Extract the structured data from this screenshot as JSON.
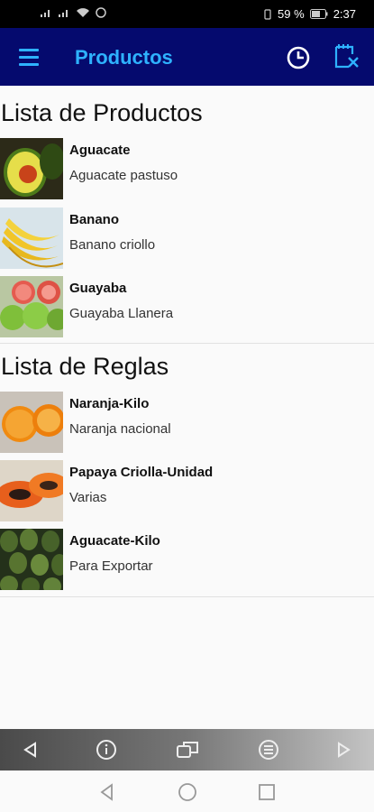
{
  "status_bar": {
    "battery_percent": "59 %",
    "time": "2:37"
  },
  "app_bar": {
    "title": "Productos",
    "icons": [
      "menu-icon",
      "clock-icon",
      "notes-edit-icon"
    ]
  },
  "productos": {
    "title": "Lista de Productos",
    "items": [
      {
        "title": "Aguacate",
        "subtitle": "Aguacate pastuso",
        "image": "avocado-image"
      },
      {
        "title": "Banano",
        "subtitle": "Banano criollo",
        "image": "banana-image"
      },
      {
        "title": "Guayaba",
        "subtitle": "Guayaba Llanera",
        "image": "guava-image"
      }
    ]
  },
  "reglas": {
    "title": "Lista de Reglas",
    "items": [
      {
        "title": "Naranja-Kilo",
        "subtitle": "Naranja nacional",
        "image": "orange-image"
      },
      {
        "title": "Papaya Criolla-Unidad",
        "subtitle": "Varias",
        "image": "papaya-image"
      },
      {
        "title": "Aguacate-Kilo",
        "subtitle": "Para Exportar",
        "image": "avocados-image"
      }
    ]
  },
  "media_bar": {
    "icons": [
      "previous-icon",
      "info-icon",
      "switch-window-icon",
      "menu-circle-icon",
      "next-icon"
    ]
  },
  "system_nav": {
    "icons": [
      "back-icon",
      "home-icon",
      "recents-icon"
    ]
  },
  "colors": {
    "app_bar": "#050a6e",
    "accent": "#2eb2ff",
    "background": "#fafafa"
  }
}
